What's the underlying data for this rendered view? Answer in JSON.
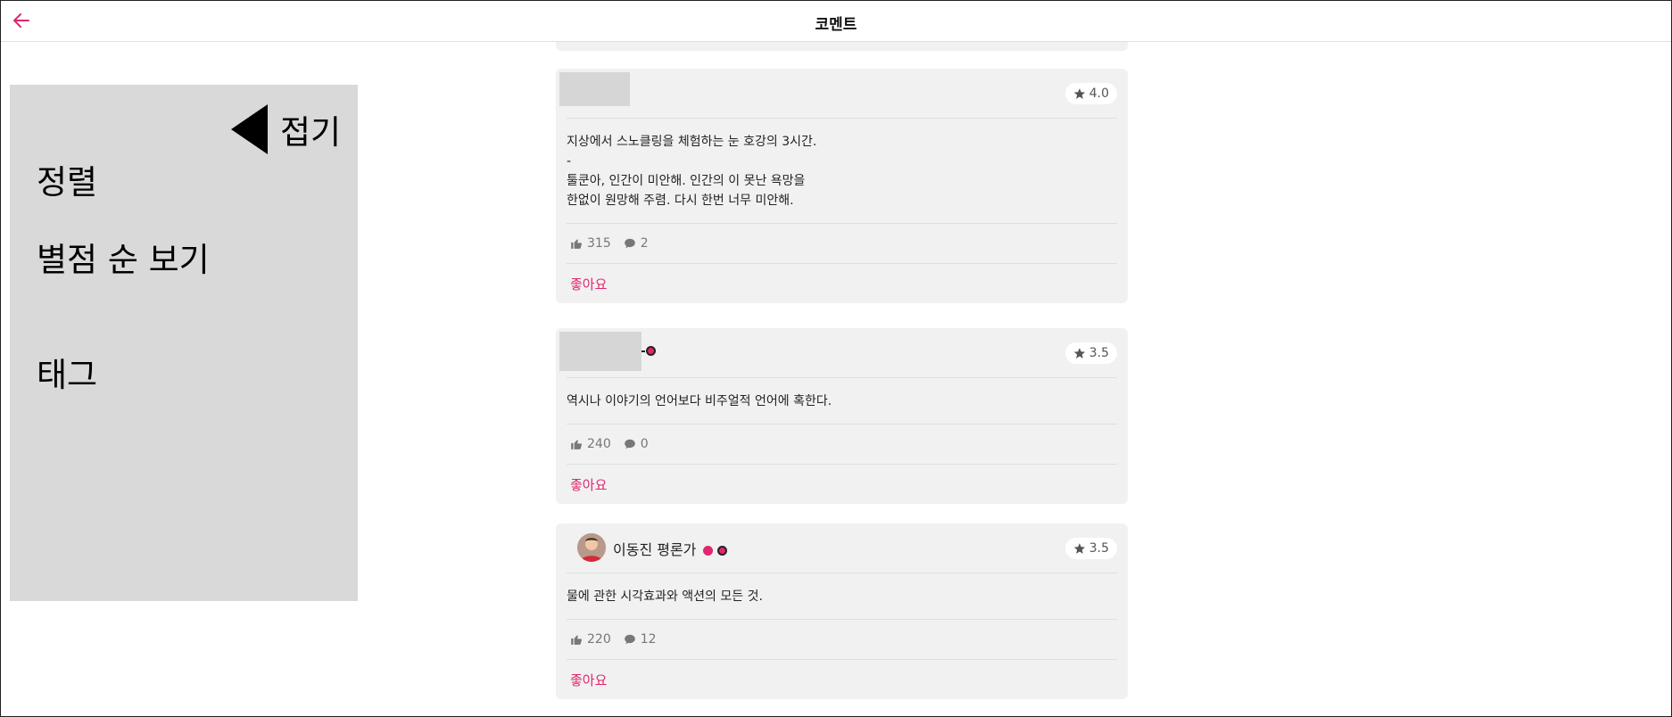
{
  "header": {
    "title": "코멘트",
    "back_icon": "arrow-left-icon",
    "accent_color": "#e0266f"
  },
  "side_panel": {
    "collapse_label": "접기",
    "items": [
      {
        "label": "정렬"
      },
      {
        "label": "별점 순 보기"
      },
      {
        "label": "태그"
      }
    ]
  },
  "comments": [
    {
      "user_name": "",
      "rating": "4.0",
      "lines": [
        "지상에서 스노클링을 체험하는 눈 호강의 3시간.",
        "-",
        "툴쿤아, 인간이 미안해. 인간의 이 못난 욕망을",
        "한없이 원망해 주렴. 다시 한번 너무 미안해."
      ],
      "likes": "315",
      "replies": "2",
      "like_label": "좋아요"
    },
    {
      "user_name": "",
      "rating": "3.5",
      "lines": [
        "역시나 이야기의 언어보다 비주얼적 언어에 혹한다."
      ],
      "likes": "240",
      "replies": "0",
      "like_label": "좋아요"
    },
    {
      "user_name": "이동진 평론가",
      "rating": "3.5",
      "lines": [
        "물에 관한 시각효과와 액션의 모든 것."
      ],
      "likes": "220",
      "replies": "12",
      "like_label": "좋아요"
    }
  ]
}
